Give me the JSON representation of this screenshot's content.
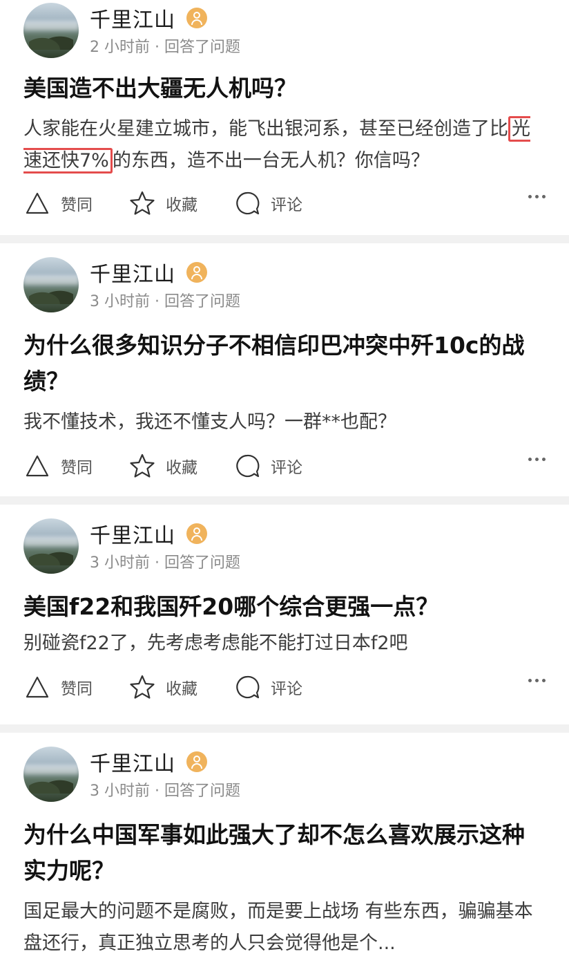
{
  "posts": [
    {
      "author": "千里江山",
      "meta": "2 小时前 · 回答了问题",
      "title": "美国造不出大疆无人机吗？",
      "answer_parts": [
        "人家能在火星建立城市，能飞出银河系，甚至已经创造了比",
        "光速还快7%",
        "的东西，造不出一台无人机？你信吗？"
      ],
      "actions": {
        "like": "赞同",
        "fav": "收藏",
        "comment": "评论"
      }
    },
    {
      "author": "千里江山",
      "meta": "3 小时前 · 回答了问题",
      "title": "为什么很多知识分子不相信印巴冲突中歼10c的战绩？",
      "answer": "我不懂技术，我还不懂支人吗？一群**也配？",
      "actions": {
        "like": "赞同",
        "fav": "收藏",
        "comment": "评论"
      }
    },
    {
      "author": "千里江山",
      "meta": "3 小时前 · 回答了问题",
      "title": "美国f22和我国歼20哪个综合更强一点？",
      "answer": "别碰瓷f22了，先考虑考虑能不能打过日本f2吧",
      "actions": {
        "like": "赞同",
        "fav": "收藏",
        "comment": "评论"
      }
    },
    {
      "author": "千里江山",
      "meta": "3 小时前 · 回答了问题",
      "title": "为什么中国军事如此强大了却不怎么喜欢展示这种实力呢？",
      "answer": "国足最大的问题不是腐败，而是要上战场 有些东西，骗骗基本盘还行，真正独立思考的人只会觉得他是个..."
    }
  ],
  "colors": {
    "highlight": "#e44c4c",
    "badge": "#f0b35c"
  },
  "icons": [
    "triangle-up-icon",
    "star-icon",
    "comment-bubble-icon",
    "more-dots-icon",
    "verified-user-badge-icon"
  ]
}
